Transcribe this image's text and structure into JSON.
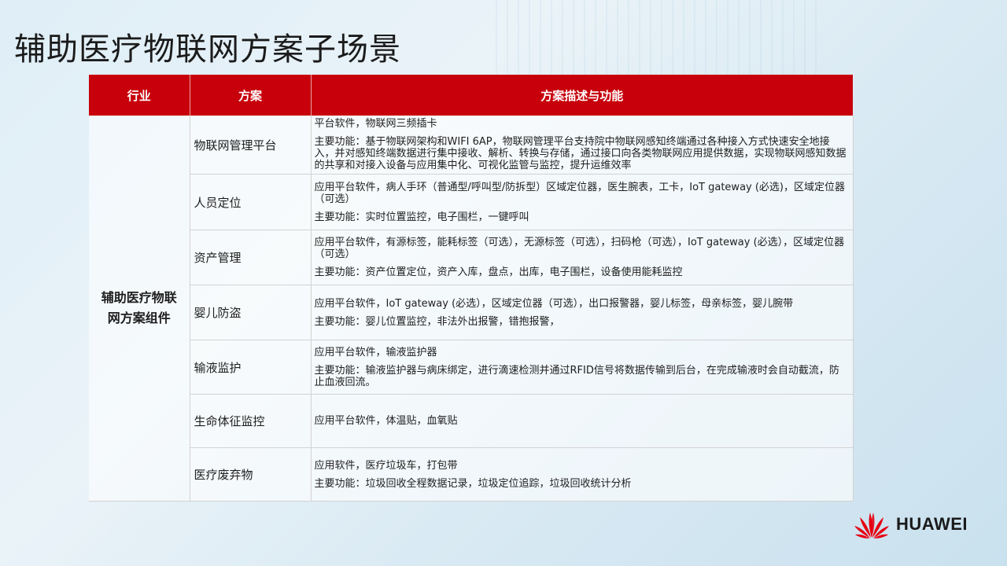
{
  "title": "辅助医疗物联网方案子场景",
  "table": {
    "headers": [
      "行业",
      "方案",
      "方案描述与功能"
    ],
    "industry": "辅助医疗物联网方案组件",
    "rows": [
      {
        "scheme": "物联网管理平台",
        "line1": "平台软件，物联网三频插卡",
        "line2": "主要功能：基于物联网架构和WIFI 6AP，物联网管理平台支持院中物联网感知终端通过各种接入方式快速安全地接入，并对感知终端数据进行集中接收、解析、转换与存储，通过接口向各类物联网应用提供数据，实现物联网感知数据的共享和对接入设备与应用集中化、可视化监管与监控，提升运维效率"
      },
      {
        "scheme": "人员定位",
        "line1": "应用平台软件，病人手环（普通型/呼叫型/防拆型）区域定位器，医生腕表，工卡，IoT gateway (必选)，区域定位器（可选）",
        "line2": "主要功能：实时位置监控，电子围栏，一键呼叫"
      },
      {
        "scheme": "资产管理",
        "line1": "应用平台软件，有源标签，能耗标签（可选），无源标签（可选），扫码枪（可选），IoT gateway (必选），区域定位器（可选）",
        "line2": "主要功能：资产位置定位，资产入库，盘点，出库，电子围栏，设备使用能耗监控"
      },
      {
        "scheme": "婴儿防盗",
        "line1": "应用平台软件，IoT gateway (必选），区域定位器（可选），出口报警器，婴儿标签，母亲标签，婴儿腕带",
        "line2": "主要功能：婴儿位置监控，非法外出报警，错抱报警，"
      },
      {
        "scheme": "输液监护",
        "line1": "应用平台软件，输液监护器",
        "line2": "主要功能：输液监护器与病床绑定，进行滴速检测并通过RFID信号将数据传输到后台，在完成输液时会自动截流，防止血液回流。"
      },
      {
        "scheme": "生命体征监控",
        "line1": "应用平台软件，体温贴，血氧贴",
        "line2": ""
      },
      {
        "scheme": "医疗废弃物",
        "line1": "应用软件，医疗垃圾车，打包带",
        "line2": "主要功能：垃圾回收全程数据记录，垃圾定位追踪，垃圾回收统计分析"
      }
    ]
  },
  "logo": {
    "text": "HUAWEI",
    "color": "#e60012"
  },
  "colors": {
    "header_bg": "#c7000b"
  }
}
